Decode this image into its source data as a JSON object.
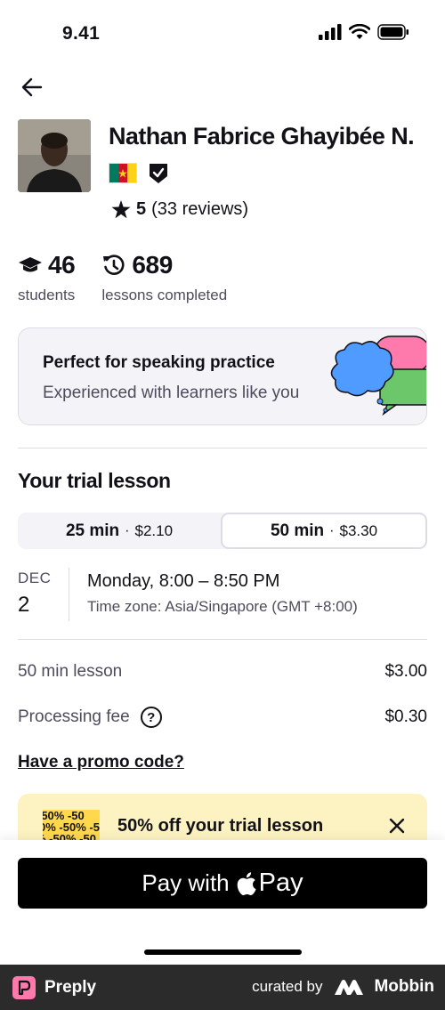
{
  "status_bar": {
    "time": "9.41"
  },
  "tutor": {
    "name": "Nathan Fabrice Ghayibée N.",
    "rating_score": "5",
    "rating_reviews": "(33 reviews)"
  },
  "stats": [
    {
      "value": "46",
      "label": "students",
      "icon": "graduation-cap-icon"
    },
    {
      "value": "689",
      "label": "lessons completed",
      "icon": "history-icon"
    }
  ],
  "practice_card": {
    "title": "Perfect for speaking practice",
    "subtitle": "Experienced with learners like you"
  },
  "trial": {
    "title": "Your trial lesson",
    "options": [
      {
        "duration": "25 min",
        "price": "$2.10",
        "selected": false
      },
      {
        "duration": "50 min",
        "price": "$3.30",
        "selected": true
      }
    ],
    "separator": "·"
  },
  "slot": {
    "month": "DEC",
    "day": "2",
    "time": "Monday, 8:00 – 8:50 PM",
    "timezone": "Time zone: Asia/Singapore (GMT +8:00)"
  },
  "pricing": {
    "lesson_label": "50 min lesson",
    "lesson_value": "$3.00",
    "fee_label": "Processing fee",
    "fee_value": "$0.30",
    "help_glyph": "?"
  },
  "promo": {
    "link": "Have a promo code?",
    "banner_text": "50% off your trial lesson",
    "banner_pattern": [
      "-50% -50",
      "0% -50% -5",
      "% -50% -50"
    ]
  },
  "pay_button": {
    "prefix": "Pay with",
    "apple_label": "Pay"
  },
  "footer": {
    "brand": "Preply",
    "curated_by": "curated by",
    "mobbin": "Mobbin"
  },
  "colors": {
    "flag_green": "#007a5e",
    "flag_red": "#ce1126",
    "flag_yellow": "#fcd116",
    "promo_bg": "#fdf3c2",
    "card_bg": "#f4f4f8",
    "preply_pink": "#ff7aac"
  }
}
